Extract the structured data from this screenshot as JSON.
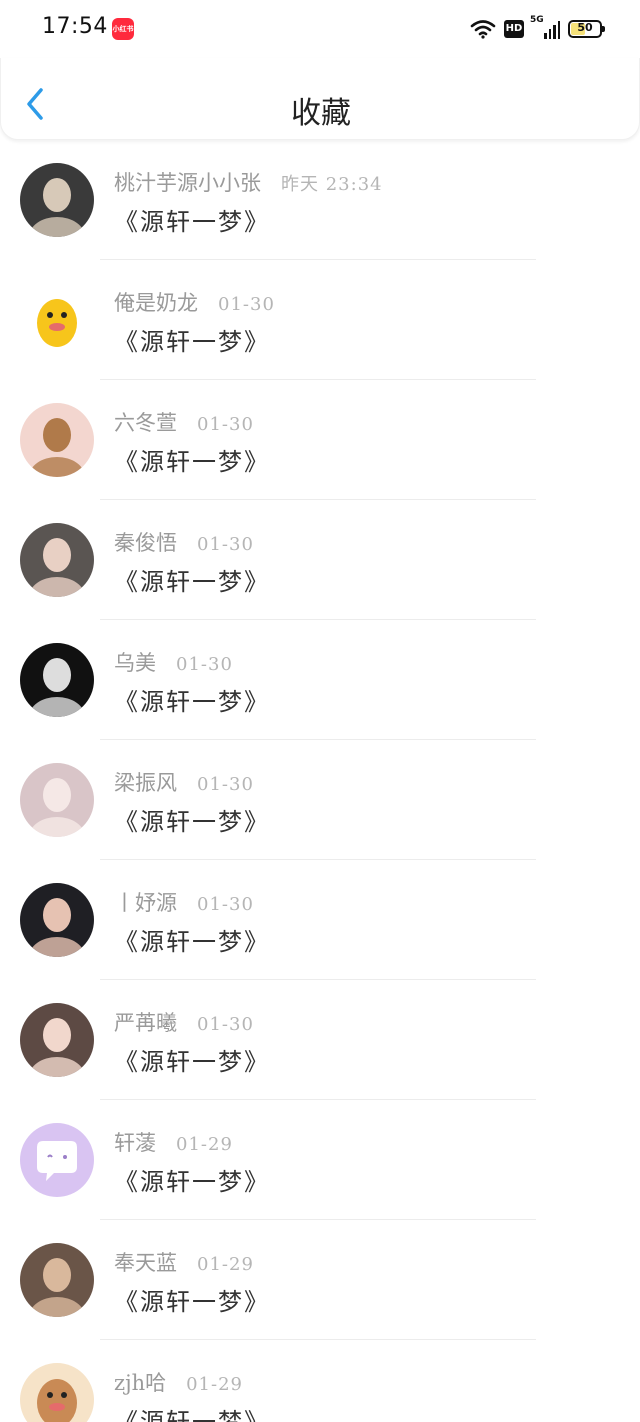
{
  "status_bar": {
    "time": "17:54",
    "app_badge": "小红书",
    "hd": "HD",
    "network": "5G",
    "battery": "50"
  },
  "header": {
    "title": "收藏"
  },
  "items": [
    {
      "name": "桃汁芋源小小张",
      "time": "昨天 23:34",
      "content": "《源轩一梦》",
      "avatar": {
        "bg": "#3a3a3a",
        "fg": "#d7c9b8",
        "type": "photo"
      }
    },
    {
      "name": "俺是奶龙",
      "time": "01-30",
      "content": "《源轩一梦》",
      "avatar": {
        "bg": "#ffffff",
        "fg": "#f7c51b",
        "type": "cartoon"
      }
    },
    {
      "name": "六冬萱",
      "time": "01-30",
      "content": "《源轩一梦》",
      "avatar": {
        "bg": "#f3d6cf",
        "fg": "#b07a4a",
        "type": "photo"
      }
    },
    {
      "name": "秦俊悟",
      "time": "01-30",
      "content": "《源轩一梦》",
      "avatar": {
        "bg": "#5a5552",
        "fg": "#e8d0c4",
        "type": "photo"
      }
    },
    {
      "name": "乌美",
      "time": "01-30",
      "content": "《源轩一梦》",
      "avatar": {
        "bg": "#111111",
        "fg": "#dddddd",
        "type": "photo"
      }
    },
    {
      "name": "梁振风",
      "time": "01-30",
      "content": "《源轩一梦》",
      "avatar": {
        "bg": "#d9c5c8",
        "fg": "#f5e8e6",
        "type": "photo"
      }
    },
    {
      "name": "丨妤源",
      "time": "01-30",
      "content": "《源轩一梦》",
      "avatar": {
        "bg": "#1f1f24",
        "fg": "#e6c2b2",
        "type": "photo"
      }
    },
    {
      "name": "严苒曦",
      "time": "01-30",
      "content": "《源轩一梦》",
      "avatar": {
        "bg": "#5d4a44",
        "fg": "#f1d7cc",
        "type": "photo"
      }
    },
    {
      "name": "轩蓤",
      "time": "01-29",
      "content": "《源轩一梦》",
      "avatar": {
        "bg": "#d9c4f2",
        "fg": "#ffffff",
        "type": "chat"
      }
    },
    {
      "name": "奉天蓝",
      "time": "01-29",
      "content": "《源轩一梦》",
      "avatar": {
        "bg": "#6a5548",
        "fg": "#d9b89c",
        "type": "photo"
      }
    },
    {
      "name": "zjh哈",
      "time": "01-29",
      "content": "《源轩一梦》",
      "avatar": {
        "bg": "#f6e3c8",
        "fg": "#c98a55",
        "type": "cartoon"
      }
    }
  ]
}
